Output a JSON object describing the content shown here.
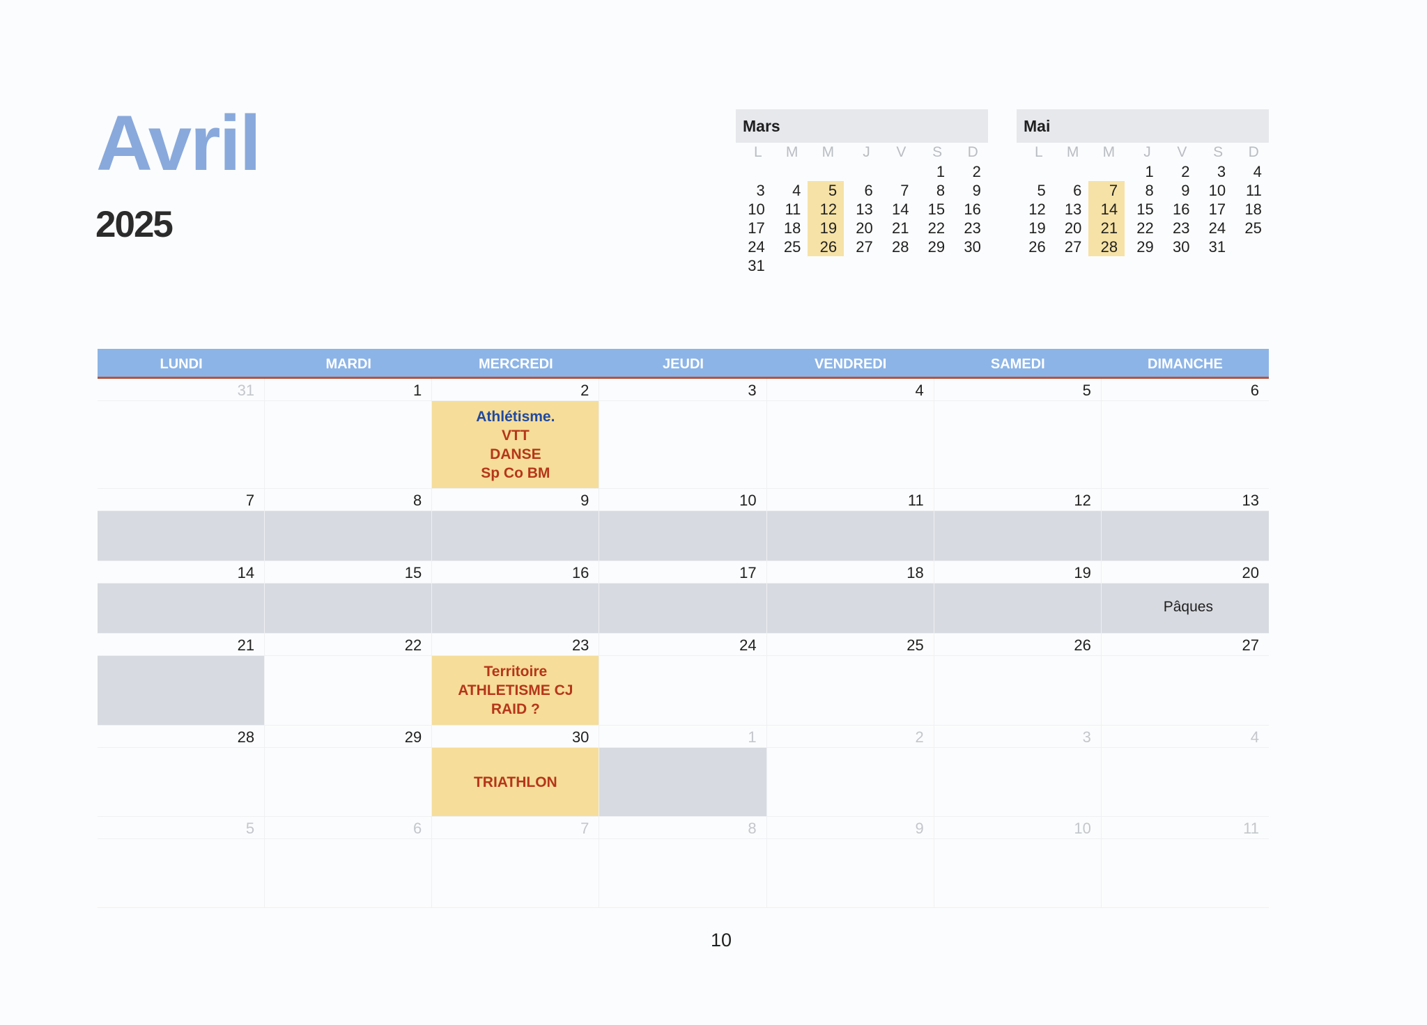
{
  "title": {
    "month": "Avril",
    "year": "2025"
  },
  "mini_calendars": [
    {
      "name": "Mars",
      "dows": [
        "L",
        "M",
        "M",
        "J",
        "V",
        "S",
        "D"
      ],
      "lead_blanks": 5,
      "days": [
        "1",
        "2",
        "3",
        "4",
        "5",
        "6",
        "7",
        "8",
        "9",
        "10",
        "11",
        "12",
        "13",
        "14",
        "15",
        "16",
        "17",
        "18",
        "19",
        "20",
        "21",
        "22",
        "23",
        "24",
        "25",
        "26",
        "27",
        "28",
        "29",
        "30",
        "31"
      ],
      "highlighted": [
        "5",
        "12",
        "19",
        "26"
      ]
    },
    {
      "name": "Mai",
      "dows": [
        "L",
        "M",
        "M",
        "J",
        "V",
        "S",
        "D"
      ],
      "lead_blanks": 3,
      "days": [
        "1",
        "2",
        "3",
        "4",
        "5",
        "6",
        "7",
        "8",
        "9",
        "10",
        "11",
        "12",
        "13",
        "14",
        "15",
        "16",
        "17",
        "18",
        "19",
        "20",
        "21",
        "22",
        "23",
        "24",
        "25",
        "26",
        "27",
        "28",
        "29",
        "30",
        "31"
      ],
      "highlighted": [
        "7",
        "14",
        "21",
        "28"
      ]
    }
  ],
  "weekdays": [
    "LUNDI",
    "MARDI",
    "MERCREDI",
    "JEUDI",
    "VENDREDI",
    "SAMEDI",
    "DIMANCHE"
  ],
  "weeks": [
    {
      "days": [
        {
          "d": "31",
          "muted": true
        },
        {
          "d": "1"
        },
        {
          "d": "2",
          "shade": "yellow",
          "event": [
            {
              "t": "Athlétisme.",
              "c": "blue"
            },
            {
              "t": "VTT",
              "c": "red"
            },
            {
              "t": "DANSE",
              "c": "red"
            },
            {
              "t": "Sp Co BM",
              "c": "red"
            }
          ]
        },
        {
          "d": "3"
        },
        {
          "d": "4"
        },
        {
          "d": "5"
        },
        {
          "d": "6"
        }
      ]
    },
    {
      "days": [
        {
          "d": "7",
          "shade": "gray"
        },
        {
          "d": "8",
          "shade": "gray"
        },
        {
          "d": "9",
          "shade": "gray"
        },
        {
          "d": "10",
          "shade": "gray"
        },
        {
          "d": "11",
          "shade": "gray"
        },
        {
          "d": "12",
          "shade": "gray"
        },
        {
          "d": "13",
          "shade": "gray"
        }
      ]
    },
    {
      "days": [
        {
          "d": "14",
          "shade": "gray"
        },
        {
          "d": "15",
          "shade": "gray"
        },
        {
          "d": "16",
          "shade": "gray"
        },
        {
          "d": "17",
          "shade": "gray"
        },
        {
          "d": "18",
          "shade": "gray"
        },
        {
          "d": "19",
          "shade": "gray"
        },
        {
          "d": "20",
          "shade": "gray",
          "note": "Pâques"
        }
      ]
    },
    {
      "days": [
        {
          "d": "21",
          "shade": "gray"
        },
        {
          "d": "22"
        },
        {
          "d": "23",
          "shade": "yellow",
          "event": [
            {
              "t": "Territoire",
              "c": "red"
            },
            {
              "t": "ATHLETISME CJ",
              "c": "red"
            },
            {
              "t": "RAID ?",
              "c": "red"
            }
          ]
        },
        {
          "d": "24"
        },
        {
          "d": "25"
        },
        {
          "d": "26"
        },
        {
          "d": "27"
        }
      ]
    },
    {
      "days": [
        {
          "d": "28"
        },
        {
          "d": "29"
        },
        {
          "d": "30",
          "shade": "yellow",
          "event": [
            {
              "t": "TRIATHLON",
              "c": "red"
            }
          ]
        },
        {
          "d": "1",
          "muted": true,
          "shade": "gray"
        },
        {
          "d": "2",
          "muted": true
        },
        {
          "d": "3",
          "muted": true
        },
        {
          "d": "4",
          "muted": true
        }
      ]
    },
    {
      "days": [
        {
          "d": "5",
          "muted": true
        },
        {
          "d": "6",
          "muted": true
        },
        {
          "d": "7",
          "muted": true
        },
        {
          "d": "8",
          "muted": true
        },
        {
          "d": "9",
          "muted": true
        },
        {
          "d": "10",
          "muted": true
        },
        {
          "d": "11",
          "muted": true
        }
      ]
    }
  ],
  "page_number": "10",
  "colors": {
    "title": "#89a9dc",
    "header": "#8db4e6",
    "highlight": "#f6dd99",
    "shade": "#d7dae0",
    "event_blue": "#2049a0",
    "event_red": "#b5361a"
  }
}
